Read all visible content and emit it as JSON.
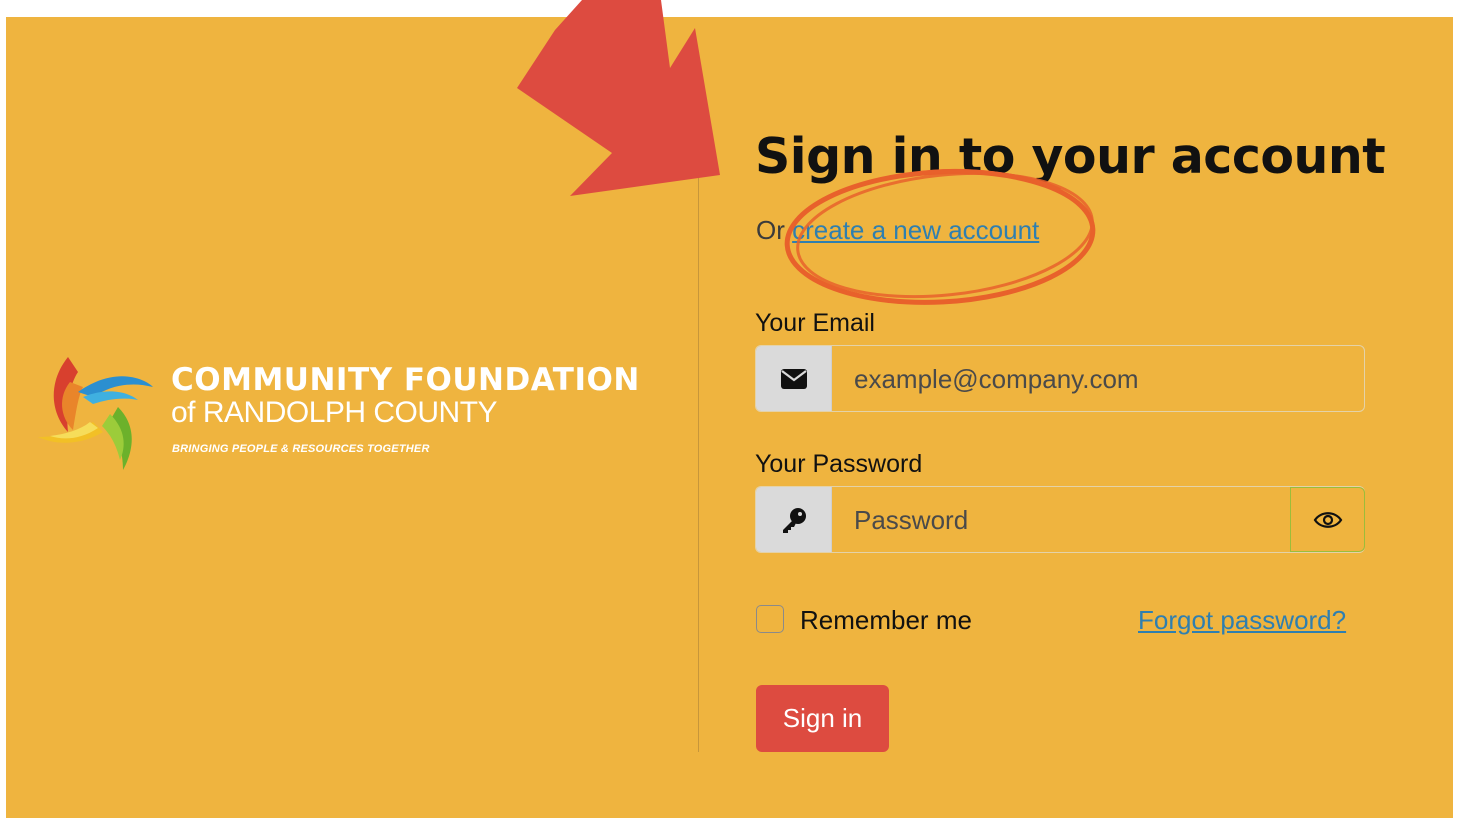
{
  "brand": {
    "name_line1": "COMMUNITY FOUNDATION",
    "name_line2": "of RANDOLPH COUNTY",
    "tagline": "BRINGING PEOPLE & RESOURCES TOGETHER"
  },
  "form": {
    "title": "Sign in to your account",
    "subline_prefix": "Or",
    "create_account_link": "create a new account",
    "email_label": "Your Email",
    "email_placeholder": "example@company.com",
    "password_label": "Your Password",
    "password_placeholder": "Password",
    "remember_label": "Remember me",
    "forgot_link": "Forgot password?",
    "submit_label": "Sign in"
  },
  "icons": {
    "email": "envelope-icon",
    "password": "key-icon",
    "toggle": "eye-icon"
  },
  "colors": {
    "background": "#efb43f",
    "accent_button": "#dd4b40",
    "link": "#2f7fb0",
    "annotation_arrow": "#dd4b40",
    "annotation_circle": "#e8612b"
  }
}
